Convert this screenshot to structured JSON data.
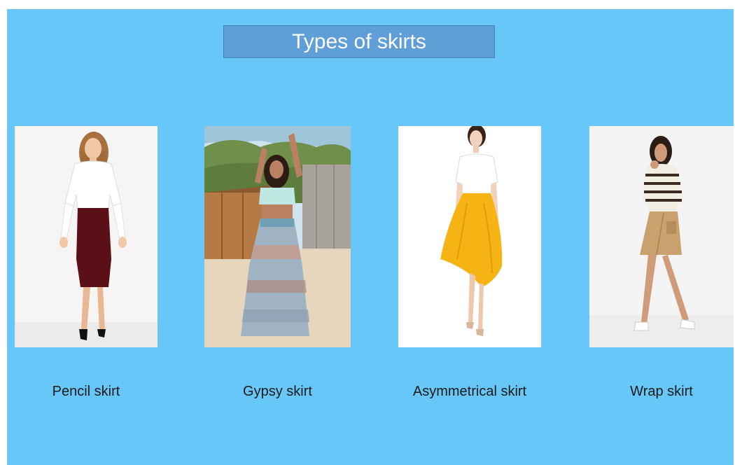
{
  "slide": {
    "title": "Types of skirts",
    "background_color": "#66c7f8",
    "title_box_color": "#5f9ed6"
  },
  "skirts": [
    {
      "label": "Pencil skirt"
    },
    {
      "label": "Gypsy skirt"
    },
    {
      "label": "Asymmetrical skirt"
    },
    {
      "label": "Wrap skirt"
    }
  ]
}
